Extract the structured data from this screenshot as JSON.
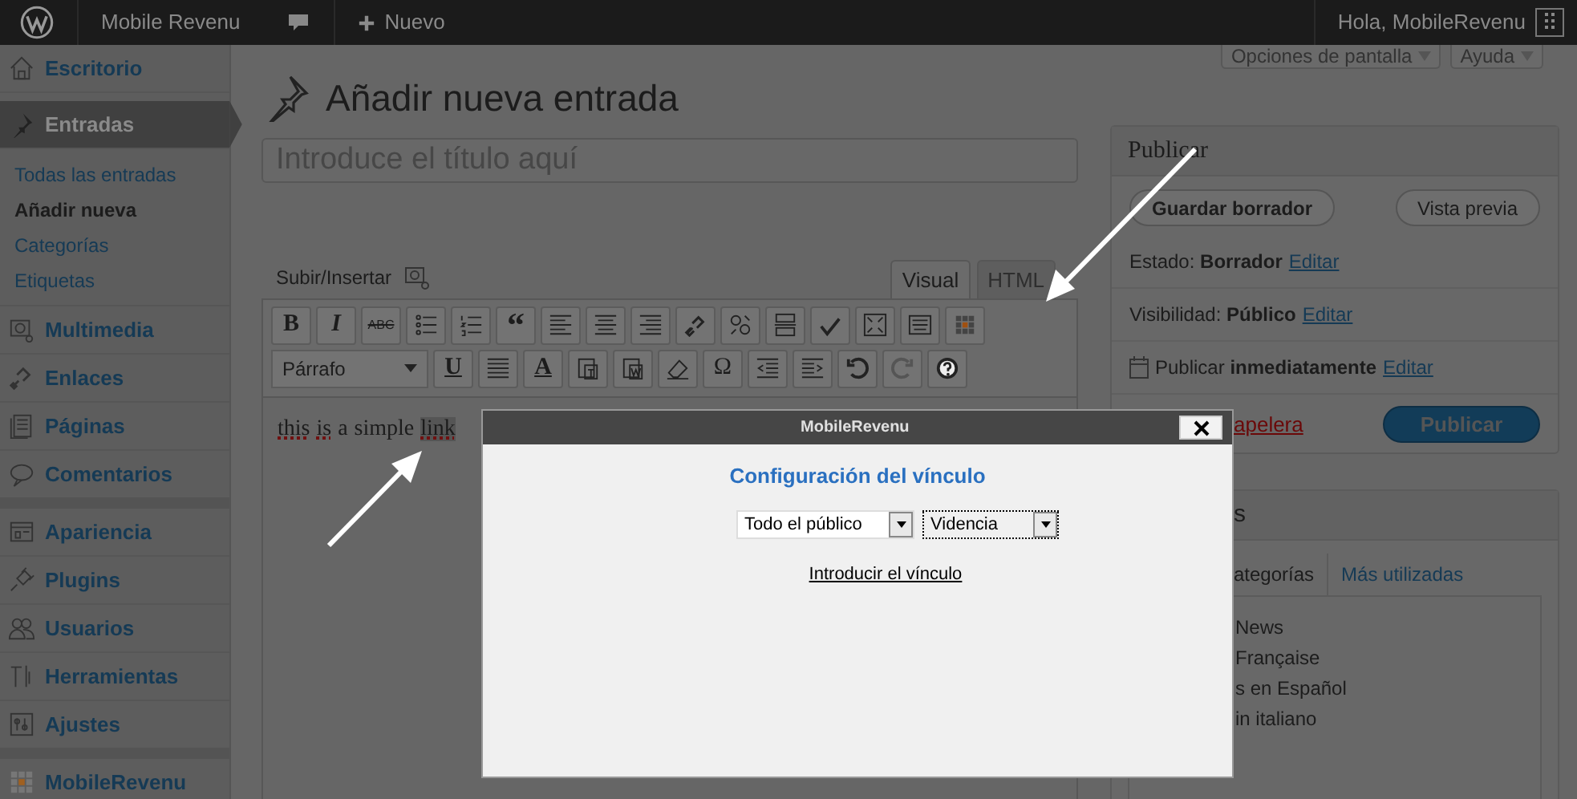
{
  "admin_bar": {
    "site": "Mobile Revenu",
    "new_label": "Nuevo",
    "greeting": "Hola, MobileRevenu"
  },
  "sidebar": {
    "items": [
      {
        "label": "Escritorio",
        "selected": false,
        "separator_after": false
      },
      {
        "label": "Entradas",
        "selected": true,
        "separator_after": false,
        "children": [
          {
            "label": "Todas las entradas",
            "selected": false
          },
          {
            "label": "Añadir nueva",
            "selected": true
          },
          {
            "label": "Categorías",
            "selected": false
          },
          {
            "label": "Etiquetas",
            "selected": false
          }
        ]
      },
      {
        "label": "Multimedia",
        "selected": false,
        "separator_after": false
      },
      {
        "label": "Enlaces",
        "selected": false,
        "separator_after": false
      },
      {
        "label": "Páginas",
        "selected": false,
        "separator_after": false
      },
      {
        "label": "Comentarios",
        "selected": false,
        "separator_after": true
      },
      {
        "label": "Apariencia",
        "selected": false,
        "separator_after": false
      },
      {
        "label": "Plugins",
        "selected": false,
        "separator_after": false
      },
      {
        "label": "Usuarios",
        "selected": false,
        "separator_after": false
      },
      {
        "label": "Herramientas",
        "selected": false,
        "separator_after": false
      },
      {
        "label": "Ajustes",
        "selected": false,
        "separator_after": true
      },
      {
        "label": "MobileRevenu",
        "selected": false,
        "separator_after": false
      }
    ]
  },
  "screen_tabs": [
    "Opciones de pantalla",
    "Ayuda"
  ],
  "page_title": "Añadir nueva entrada",
  "title_field": {
    "placeholder": "Introduce el título aquí"
  },
  "editor": {
    "upload_label": "Subir/Insertar",
    "tabs": [
      {
        "label": "Visual",
        "selected": true
      },
      {
        "label": "HTML",
        "selected": false
      }
    ],
    "toolbar_rows": [
      [
        {
          "kind": "text",
          "label": "B"
        },
        {
          "kind": "text",
          "label": "I"
        },
        {
          "kind": "text",
          "label": "ABC"
        },
        {
          "kind": "icon"
        },
        {
          "kind": "icon"
        },
        {
          "kind": "text",
          "label": "“"
        },
        {
          "kind": "icon"
        },
        {
          "kind": "icon"
        },
        {
          "kind": "icon"
        },
        {
          "kind": "icon"
        },
        {
          "kind": "icon"
        },
        {
          "kind": "icon"
        },
        {
          "kind": "icon"
        },
        {
          "kind": "icon"
        },
        {
          "kind": "icon"
        },
        {
          "kind": "icon"
        }
      ],
      [
        {
          "kind": "select",
          "label": "Párrafo"
        },
        {
          "kind": "text",
          "label": "U"
        },
        {
          "kind": "icon"
        },
        {
          "kind": "text",
          "label": "A"
        },
        {
          "kind": "icon"
        },
        {
          "kind": "icon"
        },
        {
          "kind": "icon"
        },
        {
          "kind": "text",
          "label": "Ω"
        },
        {
          "kind": "icon"
        },
        {
          "kind": "icon"
        },
        {
          "kind": "icon"
        },
        {
          "kind": "icon"
        },
        {
          "kind": "icon"
        }
      ]
    ],
    "content": [
      {
        "text": "this",
        "misspelled": true,
        "selected": false
      },
      {
        "text": "is",
        "misspelled": true,
        "selected": false
      },
      {
        "text": "a",
        "misspelled": false,
        "selected": false
      },
      {
        "text": "simple",
        "misspelled": false,
        "selected": false
      },
      {
        "text": "link",
        "misspelled": true,
        "selected": true
      }
    ]
  },
  "publish_box": {
    "title": "Publicar",
    "save_draft": "Guardar borrador",
    "preview": "Vista previa",
    "rows": [
      {
        "kind": "plain",
        "text": "Estado: **Borrador**",
        "link": "Editar"
      },
      {
        "kind": "plain",
        "text": "Visibilidad: **Público**",
        "link": "Editar"
      },
      {
        "kind": "schedule",
        "text": "Publicar **inmediatamente**",
        "link": "Editar"
      }
    ],
    "trash_link": "apelera",
    "publish_button": "Publicar"
  },
  "categories_box": {
    "title": "s",
    "tabs": [
      {
        "label": "ategorías",
        "selected": true
      },
      {
        "label": "Más utilizadas",
        "selected": false
      }
    ],
    "items": [
      "News",
      "Française",
      "s en Español",
      "in italiano"
    ]
  },
  "dialog": {
    "title": "MobileRevenu",
    "heading": "Configuración del vínculo",
    "selects": [
      {
        "value": "Todo el público",
        "focused": false
      },
      {
        "value": "Videncia",
        "focused": true
      }
    ],
    "link": "Introducir el vínculo"
  }
}
